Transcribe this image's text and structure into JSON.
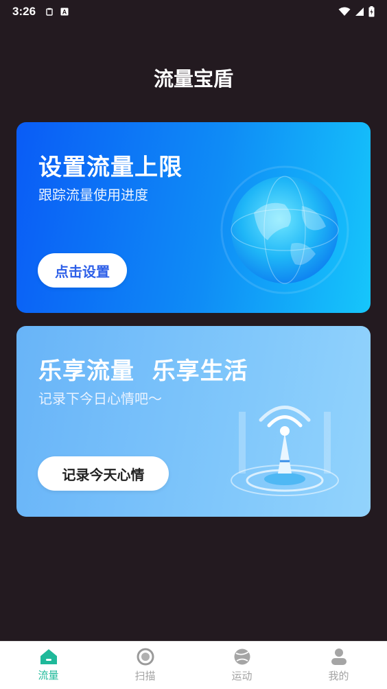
{
  "status_bar": {
    "time": "3:26",
    "left_icons": [
      "clipboard-icon",
      "a-box-icon"
    ],
    "right_icons": [
      "wifi-icon",
      "cell-signal-icon",
      "battery-icon"
    ]
  },
  "header": {
    "title": "流量宝盾"
  },
  "cards": [
    {
      "title": "设置流量上限",
      "subtitle": "跟踪流量使用进度",
      "button_label": "点击设置",
      "illustration": "globe-icon"
    },
    {
      "title": "乐享流量  乐享生活",
      "subtitle": "记录下今日心情吧～",
      "button_label": "记录今天心情",
      "illustration": "signal-tower-icon"
    }
  ],
  "tab_bar": {
    "active_index": 0,
    "items": [
      {
        "label": "流量",
        "icon": "home-icon"
      },
      {
        "label": "扫描",
        "icon": "scan-icon"
      },
      {
        "label": "运动",
        "icon": "ball-icon"
      },
      {
        "label": "我的",
        "icon": "person-icon"
      }
    ]
  },
  "colors": {
    "background": "#231a20",
    "accent": "#1fb99a",
    "card1_gradient_start": "#0a5cf6",
    "card1_gradient_end": "#16c6fb",
    "card2_gradient_start": "#68b4f8",
    "card2_gradient_end": "#92d3fc"
  }
}
